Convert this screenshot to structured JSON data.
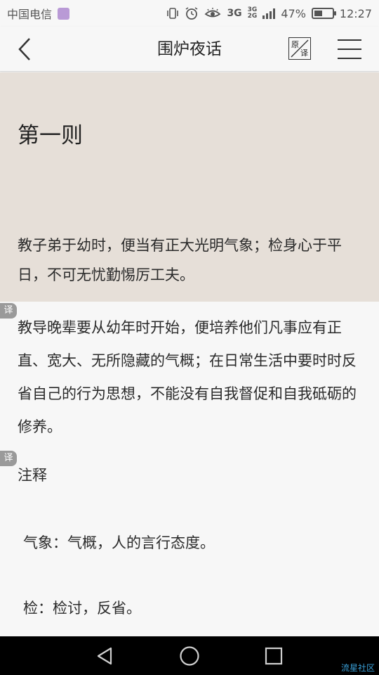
{
  "status_bar": {
    "carrier": "中国电信",
    "network_primary": "3G",
    "network_secondary_top": "3G",
    "network_secondary_bottom": "2G",
    "battery_percent": "47%",
    "battery_level": 0.47,
    "time": "12:27"
  },
  "header": {
    "title": "围炉夜话",
    "toggle_top": "原",
    "toggle_bottom": "译"
  },
  "original": {
    "chapter_title": "第一则",
    "text": "教子弟于幼时，便当有正大光明气象；检身心于平日，不可无忧勤惕厉工夫。"
  },
  "translation": {
    "tag": "译",
    "text": "教导晚辈要从幼年时开始，便培养他们凡事应有正直、宽大、无所隐藏的气概；在日常生活中要时时反省自己的行为思想，不能没有自我督促和自我砥砺的修养。"
  },
  "notes": {
    "tag": "译",
    "heading": "注释",
    "items": [
      "气象：气概，人的言行态度。",
      "检：检讨，反省。"
    ]
  },
  "watermark": "流星社区",
  "colors": {
    "original_bg": "#e6dfd8",
    "page_bg": "#f7f7f7",
    "tag_bg": "#9a9a9a",
    "navbar_bg": "#000000"
  }
}
